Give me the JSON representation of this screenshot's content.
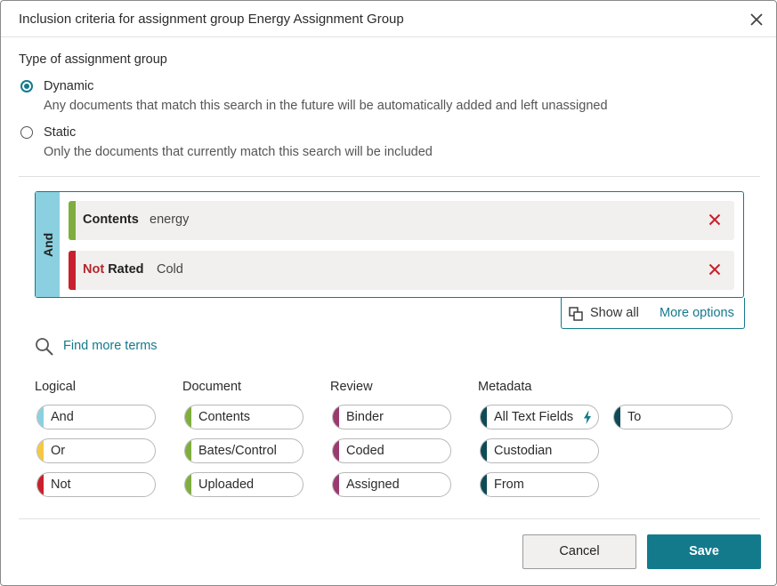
{
  "dialog": {
    "title": "Inclusion criteria for assignment group Energy Assignment Group"
  },
  "type_section": {
    "label": "Type of assignment group",
    "options": [
      {
        "label": "Dynamic",
        "description": "Any documents that match this search in the future will be automatically added and left unassigned",
        "selected": true
      },
      {
        "label": "Static",
        "description": "Only the documents that currently match this search will be included",
        "selected": false
      }
    ]
  },
  "query": {
    "operator": "And",
    "terms": [
      {
        "not": "",
        "field": "Contents",
        "value": "energy",
        "color": "#7fae3f"
      },
      {
        "not": "Not",
        "field": "Rated",
        "value": "Cold",
        "color": "#c8202c"
      }
    ],
    "show_all": "Show all",
    "more_options": "More options"
  },
  "find_more_terms": "Find more terms",
  "palette": {
    "columns": [
      {
        "heading": "Logical",
        "items": [
          {
            "label": "And",
            "color": "#8bd0e0"
          },
          {
            "label": "Or",
            "color": "#f5c842"
          },
          {
            "label": "Not",
            "color": "#c8202c"
          }
        ]
      },
      {
        "heading": "Document",
        "items": [
          {
            "label": "Contents",
            "color": "#7fae3f"
          },
          {
            "label": "Bates/Control",
            "color": "#7fae3f"
          },
          {
            "label": "Uploaded",
            "color": "#7fae3f"
          }
        ]
      },
      {
        "heading": "Review",
        "items": [
          {
            "label": "Binder",
            "color": "#9a3b6f"
          },
          {
            "label": "Coded",
            "color": "#9a3b6f"
          },
          {
            "label": "Assigned",
            "color": "#9a3b6f"
          }
        ]
      },
      {
        "heading": "Metadata",
        "items": [
          {
            "label": "All Text Fields",
            "color": "#0f4a56"
          },
          {
            "label": "Custodian",
            "color": "#0f4a56"
          },
          {
            "label": "From",
            "color": "#0f4a56"
          },
          {
            "label": "To",
            "color": "#0f4a56"
          }
        ]
      }
    ]
  },
  "footer": {
    "cancel": "Cancel",
    "save": "Save"
  },
  "colors": {
    "accent": "#137a8c",
    "danger": "#c8202c"
  }
}
